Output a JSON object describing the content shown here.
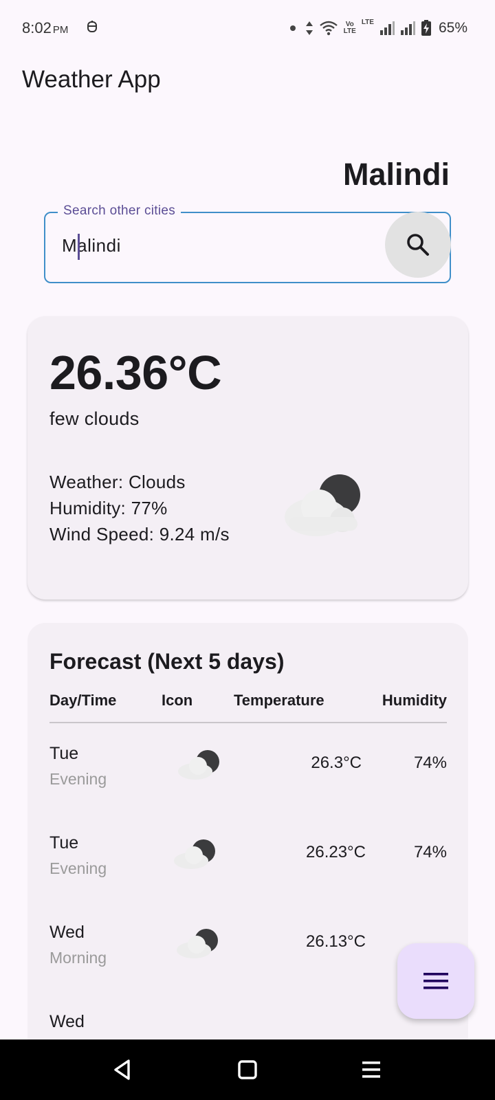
{
  "status_bar": {
    "time": "8:02",
    "ampm": "PM",
    "network_label_top": "Vo",
    "network_label_bottom": "LTE",
    "lte_label": "LTE",
    "battery": "65%"
  },
  "app_bar": {
    "title": "Weather App"
  },
  "city": {
    "name": "Malindi"
  },
  "search": {
    "label": "Search other cities",
    "value": "Malindi",
    "button_icon": "search-icon"
  },
  "current": {
    "temperature": "26.36°C",
    "description": "few clouds",
    "weather": "Weather: Clouds",
    "humidity": "Humidity: 77%",
    "wind": "Wind Speed: 9.24 m/s",
    "icon": "cloud-night-icon"
  },
  "forecast": {
    "title": "Forecast (Next 5 days)",
    "headers": [
      "Day/Time",
      "Icon",
      "Temperature",
      "Humidity"
    ],
    "rows": [
      {
        "day": "Tue",
        "time": "Evening",
        "temp": "26.3°C",
        "humidity": "74%"
      },
      {
        "day": "Tue",
        "time": "Evening",
        "temp": "26.23°C",
        "humidity": "74%"
      },
      {
        "day": "Wed",
        "time": "Morning",
        "temp": "26.13°C",
        "humidity": ""
      },
      {
        "day": "Wed",
        "time": "",
        "temp": "",
        "humidity": ""
      }
    ]
  },
  "fab": {
    "icon": "menu-icon"
  },
  "nav": {
    "back": "back-icon",
    "home": "home-icon",
    "recents": "recents-icon"
  },
  "colors": {
    "background": "#fcf7fd",
    "card": "#f4eff5",
    "accent": "#5b4d95",
    "field_border": "#3f8fc9",
    "fab": "#eaddfc"
  }
}
